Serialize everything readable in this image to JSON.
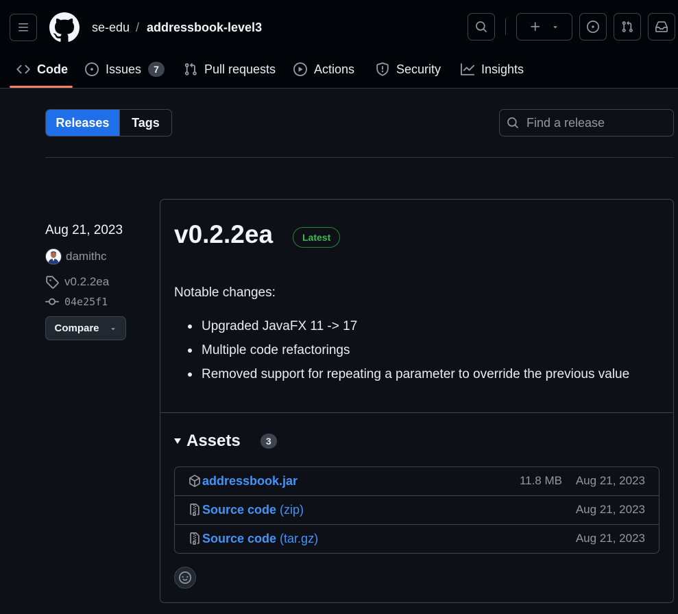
{
  "repo": {
    "owner": "se-edu",
    "separator": "/",
    "name": "addressbook-level3"
  },
  "tabs": [
    {
      "label": "Code",
      "icon": "code-icon"
    },
    {
      "label": "Issues",
      "icon": "issue-opened-icon",
      "count": "7"
    },
    {
      "label": "Pull requests",
      "icon": "git-pull-request-icon"
    },
    {
      "label": "Actions",
      "icon": "play-icon"
    },
    {
      "label": "Security",
      "icon": "shield-icon"
    },
    {
      "label": "Insights",
      "icon": "graph-icon"
    }
  ],
  "subnav": {
    "releases_label": "Releases",
    "tags_label": "Tags",
    "search_placeholder": "Find a release"
  },
  "release": {
    "date": "Aug 21, 2023",
    "author": "damithc",
    "tag": "v0.2.2ea",
    "commit": "04e25f1",
    "compare_label": "Compare",
    "title": "v0.2.2ea",
    "latest_label": "Latest",
    "notes_heading": "Notable changes:",
    "notes": [
      "Upgraded JavaFX 11 -> 17",
      "Multiple code refactorings",
      "Removed support for repeating a parameter to override the previous value"
    ]
  },
  "assets": {
    "label": "Assets",
    "count": "3",
    "items": [
      {
        "name": "addressbook.jar",
        "suffix": "",
        "size": "11.8 MB",
        "date": "Aug 21, 2023",
        "icon": "package-icon"
      },
      {
        "name": "Source code",
        "suffix": " (zip)",
        "size": "",
        "date": "Aug 21, 2023",
        "icon": "file-zip-icon"
      },
      {
        "name": "Source code",
        "suffix": " (tar.gz)",
        "size": "",
        "date": "Aug 21, 2023",
        "icon": "file-zip-icon"
      }
    ]
  },
  "colors": {
    "accent": "#1f6feb",
    "link": "#4493f8",
    "latest_green": "#3fb950",
    "tab_underline": "#f78166",
    "background": "#0d1117"
  }
}
